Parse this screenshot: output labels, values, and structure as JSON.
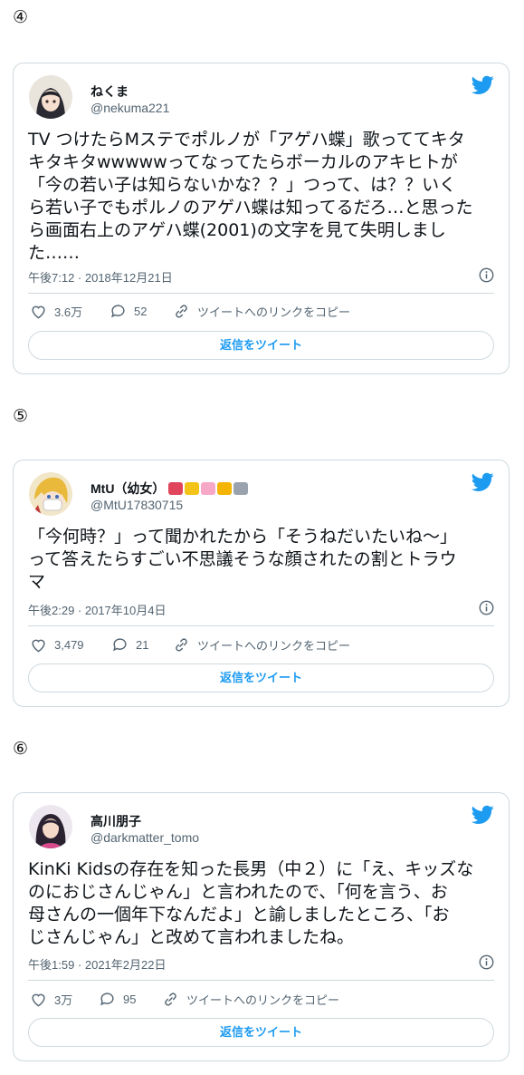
{
  "colors": {
    "accent": "#1d9bf0",
    "border": "#cfd9de",
    "muted": "#536471"
  },
  "tweets": [
    {
      "number": "④",
      "user_name": "ねくま",
      "handle": "@nekuma221",
      "text_lines": [
        "TV つけたらMステでポルノが「アゲハ蝶」歌っててキタ",
        "キタキタwwwwwってなってたらボーカルのアキヒトが",
        "「今の若い子は知らないかな？？」つって、は？？いく",
        "ら若い子でもポルノのアゲハ蝶は知ってるだろ…と思った",
        "ら画面右上のアゲハ蝶(2001)の文字を見て失明しまし",
        "た……"
      ],
      "timestamp": "午後7:12 · 2018年12月21日",
      "likes": "3.6万",
      "replies": "52",
      "copy_link": "ツイートへのリンクをコピー",
      "reply_button": "返信をツイート"
    },
    {
      "number": "⑤",
      "user_name": "MtU（幼女）",
      "handle": "@MtU17830715",
      "text_lines": [
        "「今何時？」って聞かれたから「そうねだいたいね～」",
        "って答えたらすごい不思議そうな顔されたの割とトラウ",
        "マ"
      ],
      "timestamp": "午後2:29 · 2017年10月4日",
      "likes": "3,479",
      "replies": "21",
      "copy_link": "ツイートへのリンクをコピー",
      "reply_button": "返信をツイート"
    },
    {
      "number": "⑥",
      "user_name": "高川朋子",
      "handle": "@darkmatter_tomo",
      "text_lines": [
        "KinKi Kidsの存在を知った長男（中２）に「え、キッズな",
        "のにおじさんじゃん」と言われたので、「何を言う、お",
        "母さんの一個年下なんだよ」と諭しましたところ、「お",
        "じさんじゃん」と改めて言われましたね。"
      ],
      "timestamp": "午後1:59 · 2021年2月22日",
      "likes": "3万",
      "replies": "95",
      "copy_link": "ツイートへのリンクをコピー",
      "reply_button": "返信をツイート"
    }
  ]
}
